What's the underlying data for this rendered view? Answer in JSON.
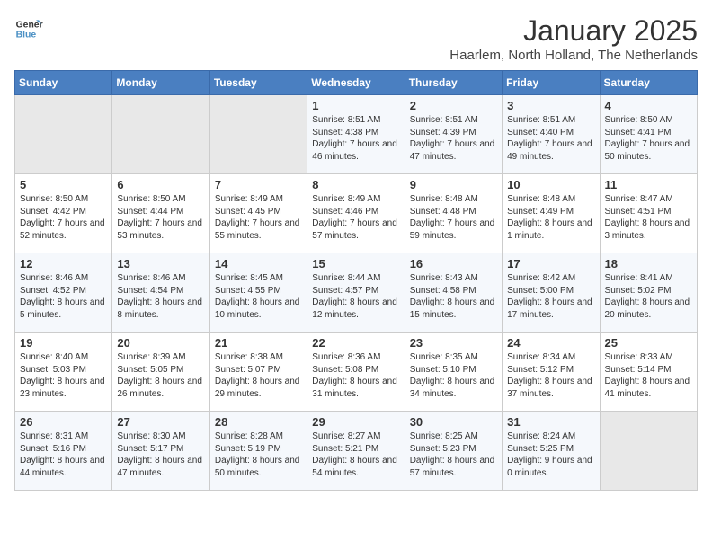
{
  "logo": {
    "line1": "General",
    "line2": "Blue"
  },
  "title": "January 2025",
  "location": "Haarlem, North Holland, The Netherlands",
  "weekdays": [
    "Sunday",
    "Monday",
    "Tuesday",
    "Wednesday",
    "Thursday",
    "Friday",
    "Saturday"
  ],
  "weeks": [
    [
      {
        "day": "",
        "info": ""
      },
      {
        "day": "",
        "info": ""
      },
      {
        "day": "",
        "info": ""
      },
      {
        "day": "1",
        "info": "Sunrise: 8:51 AM\nSunset: 4:38 PM\nDaylight: 7 hours and 46 minutes."
      },
      {
        "day": "2",
        "info": "Sunrise: 8:51 AM\nSunset: 4:39 PM\nDaylight: 7 hours and 47 minutes."
      },
      {
        "day": "3",
        "info": "Sunrise: 8:51 AM\nSunset: 4:40 PM\nDaylight: 7 hours and 49 minutes."
      },
      {
        "day": "4",
        "info": "Sunrise: 8:50 AM\nSunset: 4:41 PM\nDaylight: 7 hours and 50 minutes."
      }
    ],
    [
      {
        "day": "5",
        "info": "Sunrise: 8:50 AM\nSunset: 4:42 PM\nDaylight: 7 hours and 52 minutes."
      },
      {
        "day": "6",
        "info": "Sunrise: 8:50 AM\nSunset: 4:44 PM\nDaylight: 7 hours and 53 minutes."
      },
      {
        "day": "7",
        "info": "Sunrise: 8:49 AM\nSunset: 4:45 PM\nDaylight: 7 hours and 55 minutes."
      },
      {
        "day": "8",
        "info": "Sunrise: 8:49 AM\nSunset: 4:46 PM\nDaylight: 7 hours and 57 minutes."
      },
      {
        "day": "9",
        "info": "Sunrise: 8:48 AM\nSunset: 4:48 PM\nDaylight: 7 hours and 59 minutes."
      },
      {
        "day": "10",
        "info": "Sunrise: 8:48 AM\nSunset: 4:49 PM\nDaylight: 8 hours and 1 minute."
      },
      {
        "day": "11",
        "info": "Sunrise: 8:47 AM\nSunset: 4:51 PM\nDaylight: 8 hours and 3 minutes."
      }
    ],
    [
      {
        "day": "12",
        "info": "Sunrise: 8:46 AM\nSunset: 4:52 PM\nDaylight: 8 hours and 5 minutes."
      },
      {
        "day": "13",
        "info": "Sunrise: 8:46 AM\nSunset: 4:54 PM\nDaylight: 8 hours and 8 minutes."
      },
      {
        "day": "14",
        "info": "Sunrise: 8:45 AM\nSunset: 4:55 PM\nDaylight: 8 hours and 10 minutes."
      },
      {
        "day": "15",
        "info": "Sunrise: 8:44 AM\nSunset: 4:57 PM\nDaylight: 8 hours and 12 minutes."
      },
      {
        "day": "16",
        "info": "Sunrise: 8:43 AM\nSunset: 4:58 PM\nDaylight: 8 hours and 15 minutes."
      },
      {
        "day": "17",
        "info": "Sunrise: 8:42 AM\nSunset: 5:00 PM\nDaylight: 8 hours and 17 minutes."
      },
      {
        "day": "18",
        "info": "Sunrise: 8:41 AM\nSunset: 5:02 PM\nDaylight: 8 hours and 20 minutes."
      }
    ],
    [
      {
        "day": "19",
        "info": "Sunrise: 8:40 AM\nSunset: 5:03 PM\nDaylight: 8 hours and 23 minutes."
      },
      {
        "day": "20",
        "info": "Sunrise: 8:39 AM\nSunset: 5:05 PM\nDaylight: 8 hours and 26 minutes."
      },
      {
        "day": "21",
        "info": "Sunrise: 8:38 AM\nSunset: 5:07 PM\nDaylight: 8 hours and 29 minutes."
      },
      {
        "day": "22",
        "info": "Sunrise: 8:36 AM\nSunset: 5:08 PM\nDaylight: 8 hours and 31 minutes."
      },
      {
        "day": "23",
        "info": "Sunrise: 8:35 AM\nSunset: 5:10 PM\nDaylight: 8 hours and 34 minutes."
      },
      {
        "day": "24",
        "info": "Sunrise: 8:34 AM\nSunset: 5:12 PM\nDaylight: 8 hours and 37 minutes."
      },
      {
        "day": "25",
        "info": "Sunrise: 8:33 AM\nSunset: 5:14 PM\nDaylight: 8 hours and 41 minutes."
      }
    ],
    [
      {
        "day": "26",
        "info": "Sunrise: 8:31 AM\nSunset: 5:16 PM\nDaylight: 8 hours and 44 minutes."
      },
      {
        "day": "27",
        "info": "Sunrise: 8:30 AM\nSunset: 5:17 PM\nDaylight: 8 hours and 47 minutes."
      },
      {
        "day": "28",
        "info": "Sunrise: 8:28 AM\nSunset: 5:19 PM\nDaylight: 8 hours and 50 minutes."
      },
      {
        "day": "29",
        "info": "Sunrise: 8:27 AM\nSunset: 5:21 PM\nDaylight: 8 hours and 54 minutes."
      },
      {
        "day": "30",
        "info": "Sunrise: 8:25 AM\nSunset: 5:23 PM\nDaylight: 8 hours and 57 minutes."
      },
      {
        "day": "31",
        "info": "Sunrise: 8:24 AM\nSunset: 5:25 PM\nDaylight: 9 hours and 0 minutes."
      },
      {
        "day": "",
        "info": ""
      }
    ]
  ]
}
